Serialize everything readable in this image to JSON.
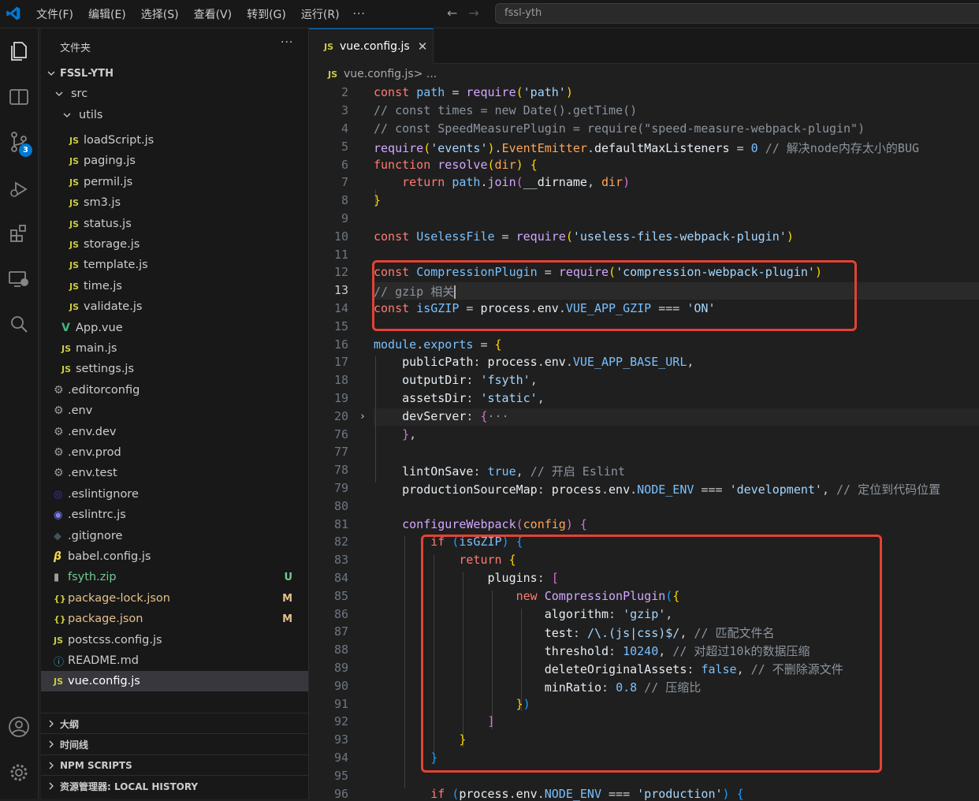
{
  "menu": [
    "文件(F)",
    "编辑(E)",
    "选择(S)",
    "查看(V)",
    "转到(G)",
    "运行(R)",
    "···"
  ],
  "search": {
    "text": "fssl-yth"
  },
  "activity": {
    "scm_badge": "3"
  },
  "explorer": {
    "title": "文件夹",
    "more": "···",
    "root": "FSSL-YTH",
    "items": [
      {
        "label": "src",
        "status": ""
      },
      {
        "label": "utils",
        "status": ""
      },
      {
        "label": "loadScript.js",
        "status": ""
      },
      {
        "label": "paging.js",
        "status": ""
      },
      {
        "label": "permil.js",
        "status": ""
      },
      {
        "label": "sm3.js",
        "status": ""
      },
      {
        "label": "status.js",
        "status": ""
      },
      {
        "label": "storage.js",
        "status": ""
      },
      {
        "label": "template.js",
        "status": ""
      },
      {
        "label": "time.js",
        "status": ""
      },
      {
        "label": "validate.js",
        "status": ""
      },
      {
        "label": "App.vue",
        "status": ""
      },
      {
        "label": "main.js",
        "status": ""
      },
      {
        "label": "settings.js",
        "status": ""
      },
      {
        "label": ".editorconfig",
        "status": ""
      },
      {
        "label": ".env",
        "status": ""
      },
      {
        "label": ".env.dev",
        "status": ""
      },
      {
        "label": ".env.prod",
        "status": ""
      },
      {
        "label": ".env.test",
        "status": ""
      },
      {
        "label": ".eslintignore",
        "status": ""
      },
      {
        "label": ".eslintrc.js",
        "status": ""
      },
      {
        "label": ".gitignore",
        "status": ""
      },
      {
        "label": "babel.config.js",
        "status": ""
      },
      {
        "label": "fsyth.zip",
        "status": "U"
      },
      {
        "label": "package-lock.json",
        "status": "M"
      },
      {
        "label": "package.json",
        "status": "M"
      },
      {
        "label": "postcss.config.js",
        "status": ""
      },
      {
        "label": "README.md",
        "status": ""
      },
      {
        "label": "vue.config.js",
        "status": ""
      }
    ],
    "sections": [
      "大纲",
      "时间线",
      "NPM SCRIPTS",
      "资源管理器: LOCAL HISTORY"
    ]
  },
  "icons": {
    "js": "JS",
    "json": "{}",
    "vue": "V",
    "gear": "gear-icon",
    "info": "info-icon"
  },
  "editor": {
    "tab_label": "vue.config.js",
    "tab_close": "✕",
    "breadcrumb_file": "vue.config.js",
    "breadcrumb_sep": " > ...",
    "line_numbers": [
      "2",
      "3",
      "4",
      "5",
      "6",
      "7",
      "8",
      "9",
      "10",
      "11",
      "12",
      "13",
      "14",
      "15",
      "16",
      "17",
      "18",
      "19",
      "20",
      "76",
      "77",
      "78",
      "79",
      "80",
      "81",
      "82",
      "83",
      "84",
      "85",
      "86",
      "87",
      "88",
      "89",
      "90",
      "91",
      "92",
      "93",
      "94",
      "95",
      "96"
    ],
    "active_line": "13"
  },
  "colors": {
    "accent": "#0078d4",
    "highlight_box": "#e34234",
    "modified": "#e2c08d",
    "untracked": "#73c991"
  }
}
